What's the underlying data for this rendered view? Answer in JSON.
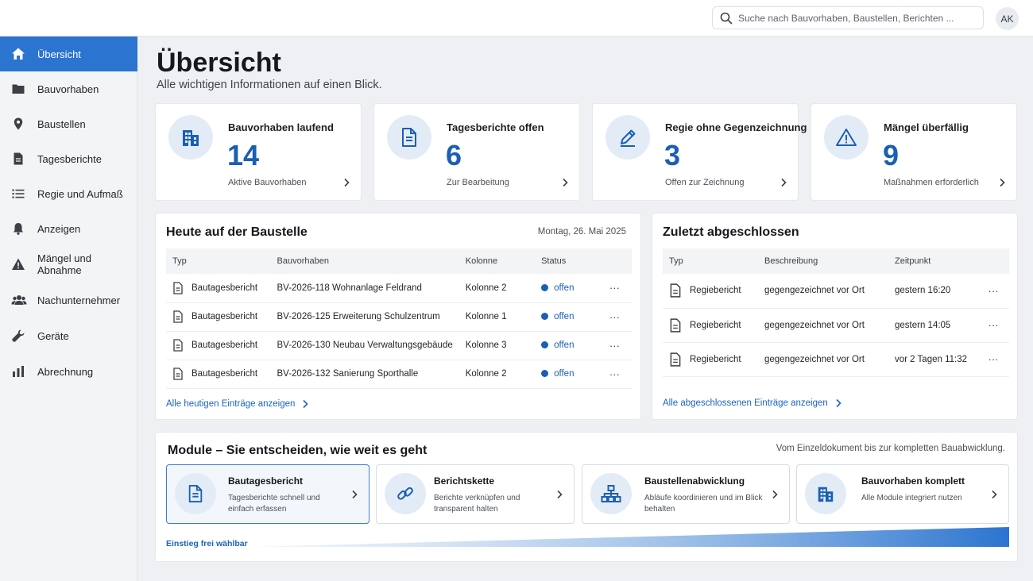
{
  "search": {
    "placeholder": "Suche nach Bauvorhaben, Baustellen, Berichten ..."
  },
  "user": {
    "initials": "AK"
  },
  "colors": {
    "accent": "#2b74cf",
    "brand_blue": "#1b5fb4",
    "icon_bg": "#e3ecf6"
  },
  "sidebar": {
    "items": [
      {
        "label": "Übersicht",
        "icon": "home-icon",
        "active": true
      },
      {
        "label": "Bauvorhaben",
        "icon": "folder-icon"
      },
      {
        "label": "Baustellen",
        "icon": "map-pin-icon"
      },
      {
        "label": "Tagesberichte",
        "icon": "document-icon"
      },
      {
        "label": "Regie und Aufmaß",
        "icon": "list-icon"
      },
      {
        "label": "Anzeigen",
        "icon": "bell-icon"
      },
      {
        "label": "Mängel und Abnahme",
        "icon": "warning-icon"
      },
      {
        "label": "Nachunternehmer",
        "icon": "people-icon"
      },
      {
        "label": "Geräte",
        "icon": "wrench-icon"
      },
      {
        "label": "Abrechnung",
        "icon": "bar-chart-icon"
      }
    ]
  },
  "page": {
    "title": "Übersicht",
    "subtitle": "Alle wichtigen Informationen auf einen Blick."
  },
  "kpis": [
    {
      "label": "Bauvorhaben laufend",
      "value": "14",
      "sub": "Aktive Bauvorhaben",
      "icon": "building-icon"
    },
    {
      "label": "Tagesberichte offen",
      "value": "6",
      "sub": "Zur Bearbeitung",
      "icon": "document-icon"
    },
    {
      "label": "Regie ohne Gegenzeichnung",
      "value": "3",
      "sub": "Offen zur Zeichnung",
      "icon": "pen-icon"
    },
    {
      "label": "Mängel überfällig",
      "value": "9",
      "sub": "Maßnahmen erforderlich",
      "icon": "warning-icon"
    }
  ],
  "today": {
    "title": "Heute auf der Baustelle",
    "date": "Montag, 26. Mai 2025",
    "columns": [
      "Typ",
      "Bauvorhaben",
      "Kolonne",
      "Status"
    ],
    "rows": [
      {
        "typ": "Bautagesbericht",
        "bauvorhaben": "BV-2026-118 Wohnanlage Feldrand",
        "kolonne": "Kolonne 2",
        "status": "offen"
      },
      {
        "typ": "Bautagesbericht",
        "bauvorhaben": "BV-2026-125 Erweiterung Schulzentrum",
        "kolonne": "Kolonne 1",
        "status": "offen"
      },
      {
        "typ": "Bautagesbericht",
        "bauvorhaben": "BV-2026-130 Neubau Verwaltungsgebäude",
        "kolonne": "Kolonne 3",
        "status": "offen"
      },
      {
        "typ": "Bautagesbericht",
        "bauvorhaben": "BV-2026-132 Sanierung Sporthalle",
        "kolonne": "Kolonne 2",
        "status": "offen"
      }
    ],
    "link": "Alle heutigen Einträge anzeigen"
  },
  "recent": {
    "title": "Zuletzt abgeschlossen",
    "columns": [
      "Typ",
      "Beschreibung",
      "Zeitpunkt"
    ],
    "rows": [
      {
        "typ": "Regiebericht",
        "beschreibung": "gegengezeichnet vor Ort",
        "zeitpunkt": "gestern 16:20"
      },
      {
        "typ": "Regiebericht",
        "beschreibung": "gegengezeichnet vor Ort",
        "zeitpunkt": "gestern 14:05"
      },
      {
        "typ": "Regiebericht",
        "beschreibung": "gegengezeichnet vor Ort",
        "zeitpunkt": "vor 2 Tagen 11:32"
      }
    ],
    "link": "Alle abgeschlossenen Einträge anzeigen"
  },
  "modules": {
    "title": "Module – Sie entscheiden, wie weit es geht",
    "note": "Vom Einzeldokument bis zur kompletten Bauabwicklung.",
    "items": [
      {
        "title": "Bautagesbericht",
        "desc": "Tagesberichte schnell und einfach erfassen",
        "icon": "document-icon",
        "selected": true
      },
      {
        "title": "Berichtskette",
        "desc": "Berichte verknüpfen und transparent halten",
        "icon": "link-icon"
      },
      {
        "title": "Baustellenabwicklung",
        "desc": "Abläufe koordinieren und im Blick behalten",
        "icon": "hierarchy-icon"
      },
      {
        "title": "Bauvorhaben komplett",
        "desc": "Alle Module integriert nutzen",
        "icon": "building-icon"
      }
    ],
    "entry": "Einstieg frei wählbar"
  },
  "more_label": "···"
}
